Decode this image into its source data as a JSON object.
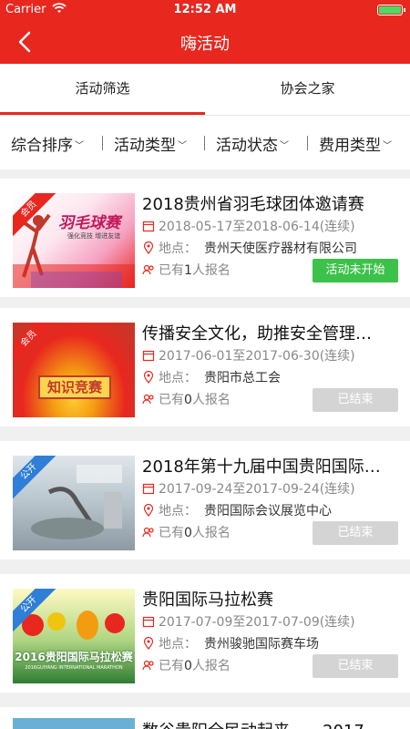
{
  "status_bar": {
    "carrier": "Carrier",
    "time": "12:52 AM"
  },
  "nav": {
    "title": "嗨活动"
  },
  "tabs": [
    {
      "label": "活动筛选",
      "active": true
    },
    {
      "label": "协会之家",
      "active": false
    }
  ],
  "filters": [
    {
      "label": "综合排序"
    },
    {
      "label": "活动类型"
    },
    {
      "label": "活动状态"
    },
    {
      "label": "费用类型"
    }
  ],
  "labels": {
    "location_prefix": "地点：",
    "signup_prefix": "已有",
    "signup_suffix": "人报名"
  },
  "activities": [
    {
      "title": "2018贵州省羽毛球团体邀请赛",
      "date": "2018-05-17至2018-06-14(连续)",
      "location": "贵州天使医疗器材有限公司",
      "signup_count": "1",
      "status": "活动未开始",
      "ribbon": "会员",
      "thumb_text": "羽毛球赛",
      "thumb_subtext": "强化竞技 增进友谊"
    },
    {
      "title": "传播安全文化，助推安全管理…",
      "date": "2017-06-01至2017-06-30(连续)",
      "location": "贵阳市总工会",
      "signup_count": "0",
      "status": "已结束",
      "ribbon": "会员",
      "thumb_text": "知识竞赛"
    },
    {
      "title": "2018年第十九届中国贵阳国际…",
      "date": "2017-09-24至2017-09-24(连续)",
      "location": "贵阳国际会议展览中心",
      "signup_count": "0",
      "status": "已结束",
      "ribbon": "公开"
    },
    {
      "title": "贵阳国际马拉松赛",
      "date": "2017-07-09至2017-07-09(连续)",
      "location": "贵州骏驰国际赛车场",
      "signup_count": "0",
      "status": "已结束",
      "ribbon": "公开",
      "thumb_text": "2016贵阳国际马拉松赛",
      "thumb_subtext": "2016GUIYANG INTERNATIONAL MARATHON"
    }
  ],
  "peek": {
    "title": "数谷贵阳全民动起来——2017…"
  },
  "colors": {
    "brand": "#e8271f",
    "green": "#3cc24a",
    "disabled": "#d4d4d4"
  },
  "icons": {
    "back": "chevron-left-icon",
    "calendar": "calendar-icon",
    "location": "location-pin-icon",
    "people": "people-icon"
  }
}
